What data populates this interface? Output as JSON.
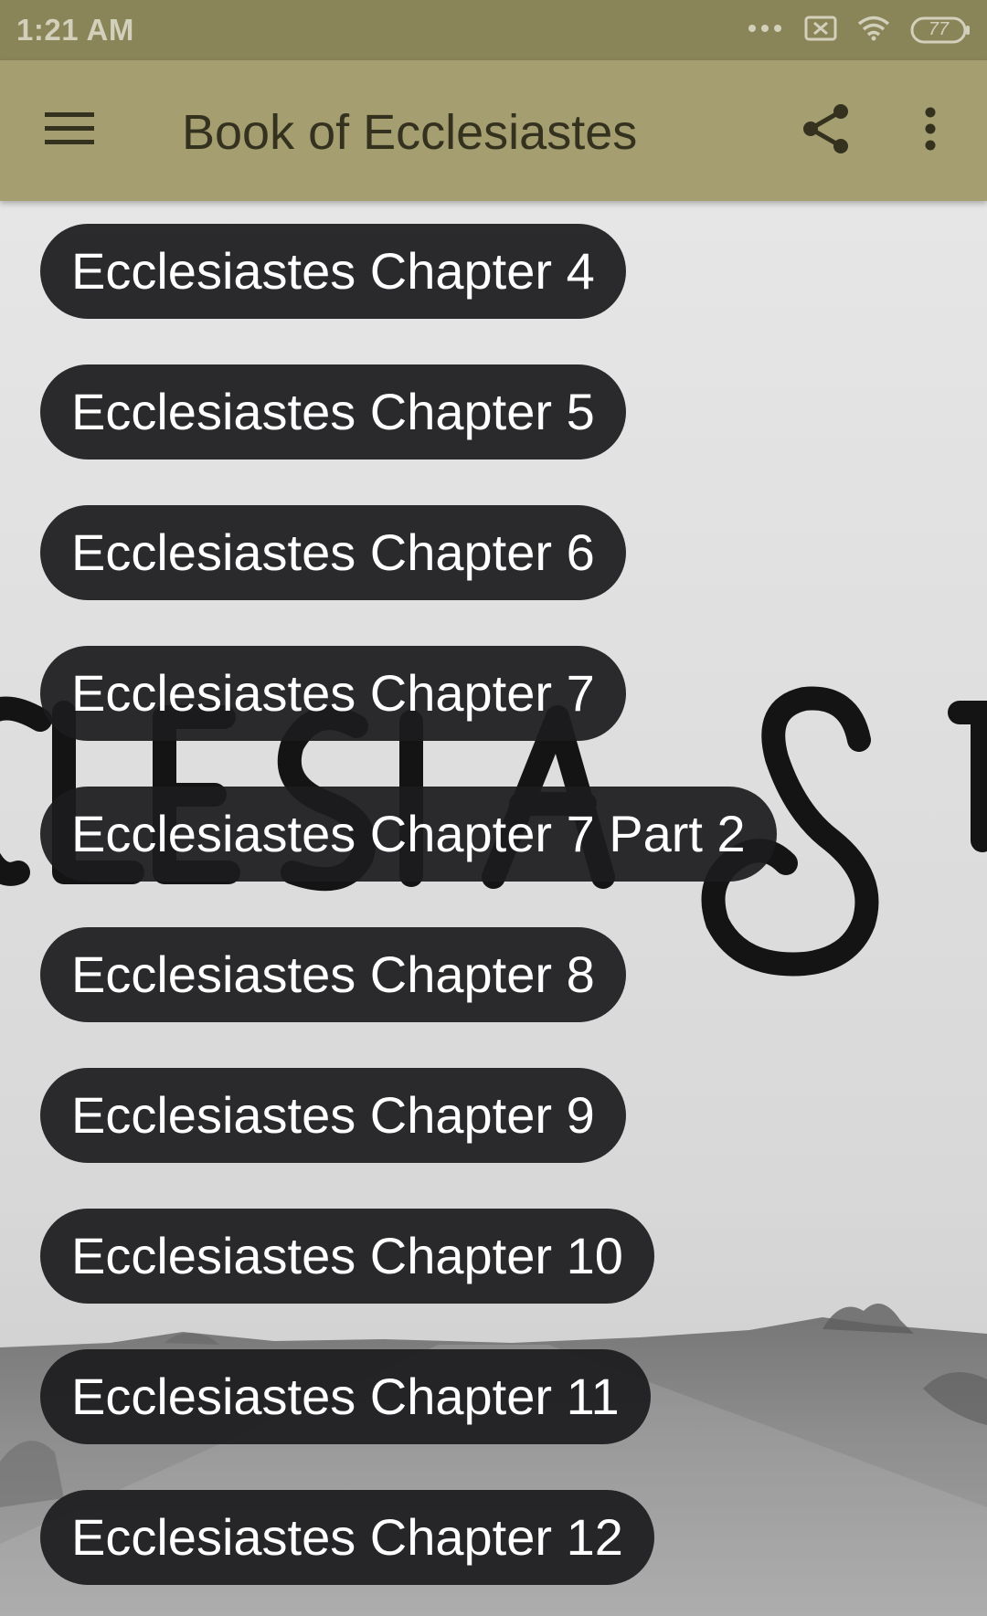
{
  "status_bar": {
    "time": "1:21 AM",
    "battery": "77"
  },
  "app_bar": {
    "title": "Book of Ecclesiastes",
    "menu_icon": "hamburger-menu-icon",
    "share_icon": "share-icon",
    "more_icon": "more-vertical-icon"
  },
  "background": {
    "lettering": "CLESIAST"
  },
  "chapters": [
    {
      "label": "Ecclesiastes Chapter 4"
    },
    {
      "label": "Ecclesiastes Chapter 5"
    },
    {
      "label": "Ecclesiastes Chapter 6"
    },
    {
      "label": "Ecclesiastes Chapter 7"
    },
    {
      "label": "Ecclesiastes Chapter 7 Part 2"
    },
    {
      "label": "Ecclesiastes Chapter 8"
    },
    {
      "label": "Ecclesiastes Chapter 9"
    },
    {
      "label": "Ecclesiastes Chapter 10"
    },
    {
      "label": "Ecclesiastes Chapter 11"
    },
    {
      "label": "Ecclesiastes Chapter 12"
    }
  ],
  "colors": {
    "status_bar": "#8a8459",
    "app_bar": "#a49e70",
    "button_bg": "#1c1c1e",
    "button_text": "#ffffff"
  }
}
